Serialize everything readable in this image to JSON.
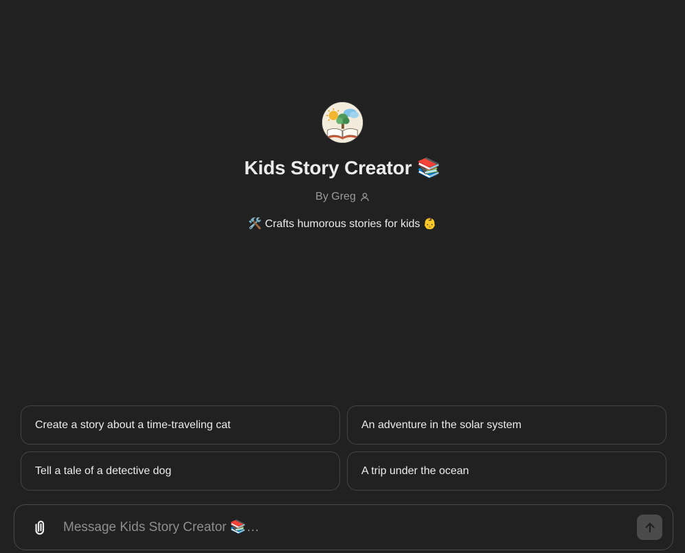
{
  "gpt": {
    "title": "Kids Story Creator 📚",
    "author": "By Greg",
    "description": "🛠️ Crafts humorous stories for kids 👶"
  },
  "suggestions": [
    {
      "label": "Create a story about a time-traveling cat"
    },
    {
      "label": "An adventure in the solar system"
    },
    {
      "label": "Tell a tale of a detective dog"
    },
    {
      "label": "A trip under the ocean"
    }
  ],
  "composer": {
    "placeholder": "Message Kids Story Creator 📚…",
    "value": ""
  },
  "icons": {
    "avatar": "storybook-avatar",
    "author": "person-icon",
    "attach": "paperclip-icon",
    "send": "arrow-up-icon"
  },
  "colors": {
    "background": "#212121",
    "text": "#ececec",
    "muted": "#9b9b9b",
    "border": "#444444",
    "send_button": "#4b4b4b"
  }
}
